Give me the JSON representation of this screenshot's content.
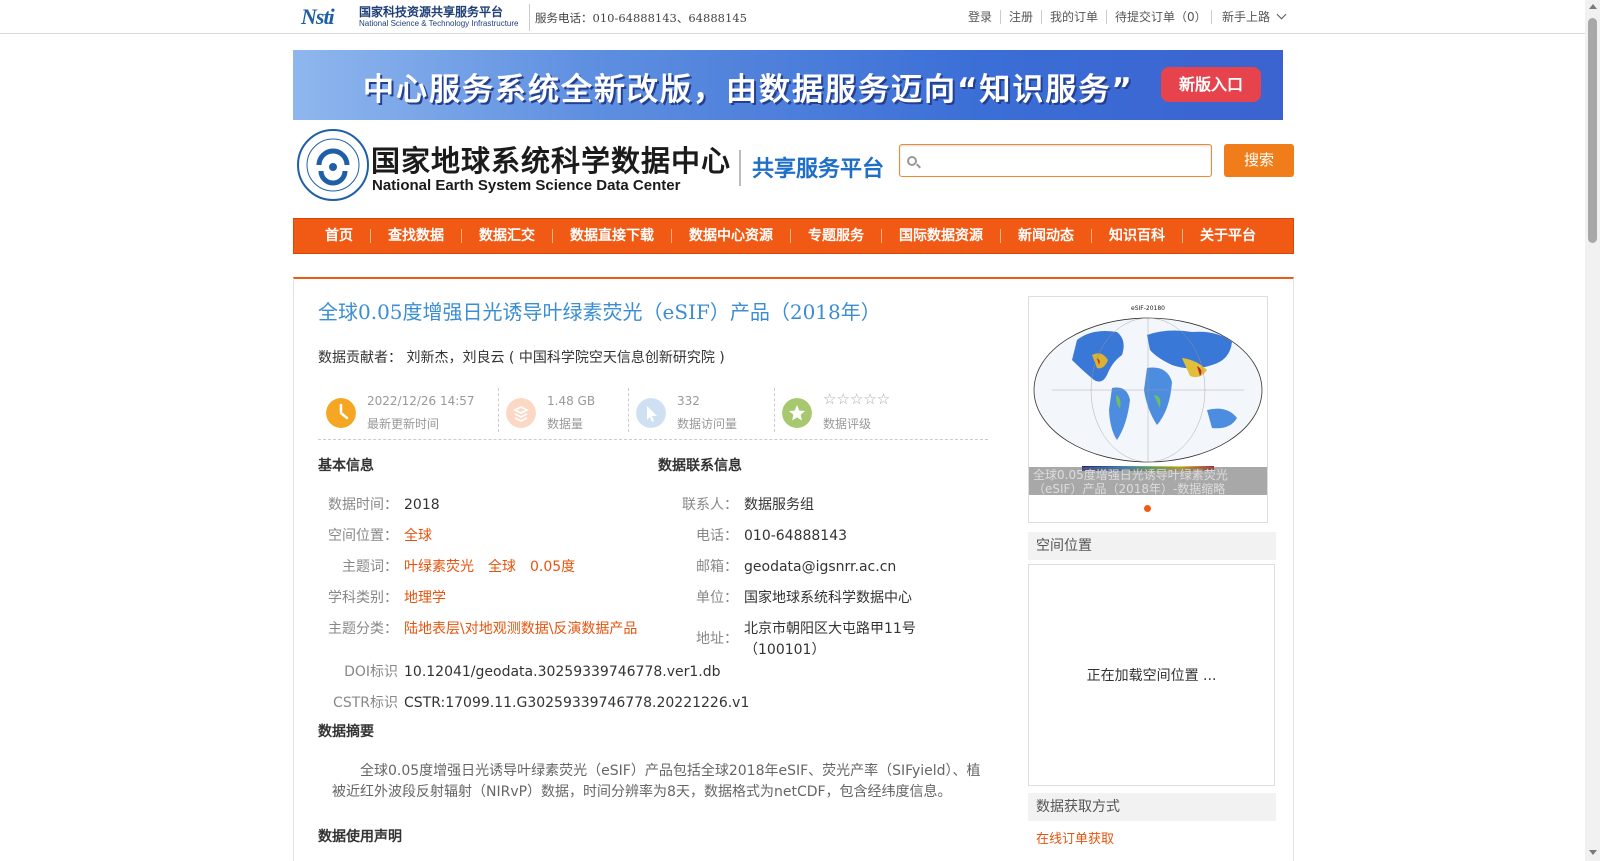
{
  "topbar": {
    "nsti_mark": "Nsti",
    "nsti_cn": "国家科技资源共享服务平台",
    "nsti_en": "National Science & Technology Infrastructure",
    "phone": "服务电话：010-64888143、64888145",
    "links": [
      "登录",
      "注册",
      "我的订单",
      "待提交订单（0）"
    ],
    "guide": "新手上路"
  },
  "banner": {
    "text": "中心服务系统全新改版，由数据服务迈向“知识服务”",
    "button": "新版入口"
  },
  "header": {
    "title_cn": "国家地球系统科学数据中心",
    "title_en": "National Earth System Science Data Center",
    "platform": "共享服务平台",
    "search_placeholder": "",
    "search_button": "搜索"
  },
  "nav": [
    "首页",
    "查找数据",
    "数据汇交",
    "数据直接下载",
    "数据中心资源",
    "专题服务",
    "国际数据资源",
    "新闻动态",
    "知识百科",
    "关于平台"
  ],
  "dataset": {
    "title": "全球0.05度增强日光诱导叶绿素荧光（eSIF）产品（2018年）",
    "contributor_label": "数据贡献者：",
    "contributor": "刘新杰，刘良云 ( 中国科学院空天信息创新研究院 )"
  },
  "stats": {
    "updated": {
      "value": "2022/12/26 14:57",
      "label": "最新更新时间"
    },
    "size": {
      "value": "1.48 GB",
      "label": "数据量"
    },
    "visits": {
      "value": "332",
      "label": "数据访问量"
    },
    "rating": {
      "stars": "☆☆☆☆☆",
      "label": "数据评级",
      "value": 0,
      "max": 5
    }
  },
  "basic": {
    "heading": "基本信息",
    "rows": [
      {
        "label": "数据时间：",
        "value": "2018"
      },
      {
        "label": "空间位置：",
        "value": "全球"
      },
      {
        "label": "主题词：",
        "value": "叶绿素荧光　全球　0.05度"
      },
      {
        "label": "学科类别：",
        "value": "地理学"
      },
      {
        "label": "主题分类：",
        "value": "陆地表层\\对地观测数据\\反演数据产品"
      },
      {
        "label": "DOI标识",
        "value": "10.12041/geodata.30259339746778.ver1.db"
      },
      {
        "label": "CSTR标识",
        "value": "CSTR:17099.11.G30259339746778.20221226.v1"
      }
    ]
  },
  "contact": {
    "heading": "数据联系信息",
    "rows": [
      {
        "label": "联系人：",
        "value": "数据服务组"
      },
      {
        "label": "电话：",
        "value": "010-64888143"
      },
      {
        "label": "邮箱：",
        "value": "geodata@igsnrr.ac.cn"
      },
      {
        "label": "单位：",
        "value": "国家地球系统科学数据中心"
      },
      {
        "label": "地址：",
        "value": "北京市朝阳区大屯路甲11号",
        "value2": "（100101）"
      }
    ]
  },
  "abstract": {
    "heading": "数据摘要",
    "text": "全球0.05度增强日光诱导叶绿素荧光（eSIF）产品包括全球2018年eSIF、荧光产率（SIFyield）、植被近红外波段反射辐射（NIRvP）数据，时间分辨率为8天，数据格式为netCDF，包含经纬度信息。"
  },
  "usage": {
    "heading": "数据使用声明"
  },
  "sidebar": {
    "map_title": "eSIF-20180",
    "thumb_caption": "全球0.05度增强日光诱导叶绿素荧光（eSIF）产品（2018年）-数据缩略",
    "spatial_heading": "空间位置",
    "spatial_loading": "正在加载空间位置 ...",
    "access_heading": "数据获取方式",
    "access_link": "在线订单获取"
  },
  "colors": {
    "accent": "#f05a14",
    "title_blue": "#3b8ed3",
    "link_orange": "#e5540e"
  }
}
